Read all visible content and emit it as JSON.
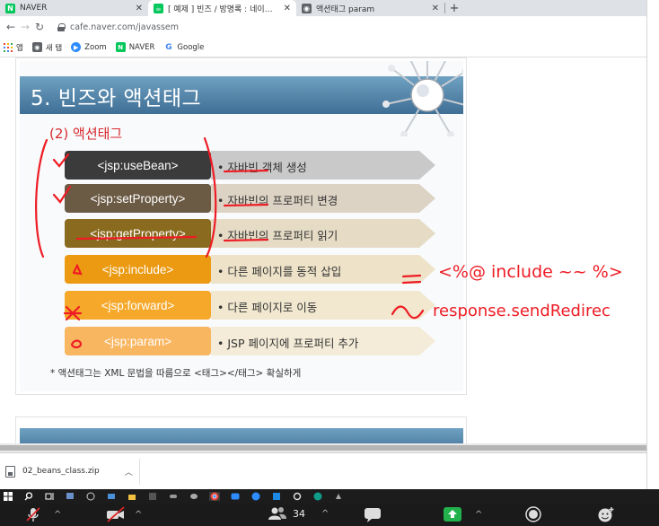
{
  "tabs": [
    {
      "title": "NAVER",
      "favicon": "naver-icon",
      "active": false
    },
    {
      "title": "[ 예제 ] 빈즈 / 방명록 : 네이버 카페",
      "favicon": "cafe-icon",
      "active": true
    },
    {
      "title": "액션태그 param",
      "favicon": "globe-icon",
      "active": false
    }
  ],
  "address": {
    "url": "cafe.naver.com/javassem"
  },
  "bookmarks": [
    {
      "label": "앱",
      "icon": "apps-icon"
    },
    {
      "label": "새 탭",
      "icon": "globe-icon"
    },
    {
      "label": "Zoom",
      "icon": "zoom-icon"
    },
    {
      "label": "NAVER",
      "icon": "naver-icon"
    },
    {
      "label": "Google",
      "icon": "google-icon"
    }
  ],
  "slide": {
    "title": "5. 빈즈와 액션태그",
    "subtitle": "(2) 액션태그",
    "rows": [
      {
        "tag": "<jsp:useBean>",
        "desc": "• 자바빈 객체 생성",
        "color": "#3b3b3b",
        "arrow": "#c9c9c9"
      },
      {
        "tag": "<jsp:setProperty>",
        "desc": "• 자바빈의 프로퍼티 변경",
        "color": "#6b5a44",
        "arrow": "#ddd3c4"
      },
      {
        "tag": "<jsp:getProperty>",
        "desc": "• 자바빈의 프로퍼티 읽기",
        "color": "#8a6a1e",
        "arrow": "#e6dcc6"
      },
      {
        "tag": "<jsp:include>",
        "desc": "• 다른 페이지를 동적 삽입",
        "color": "#eb9a12",
        "arrow": "#eee3c8"
      },
      {
        "tag": "<jsp:forward>",
        "desc": "• 다른 페이지로 이동",
        "color": "#f5a82a",
        "arrow": "#f2e8cf"
      },
      {
        "tag": "<jsp:param>",
        "desc": "• JSP 페이지에 프로퍼티 추가",
        "color": "#f9b660",
        "arrow": "#f4ecd8"
      }
    ],
    "footnote": "* 액션태그는 XML 문법을 따름으로 <태그></태그> 확실하게"
  },
  "annotations": {
    "include_note": "<%@ include ~~ %>",
    "forward_note": "response.sendRedirec",
    "color": "#ee1c24"
  },
  "download": {
    "filename": "02_beans_class.zip"
  },
  "zoom": {
    "participants": "34"
  }
}
